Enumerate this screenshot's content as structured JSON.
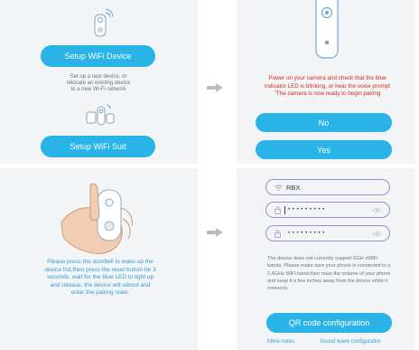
{
  "setup": {
    "wifi_device_label": "Setup WiFi Device",
    "wifi_device_desc": [
      "Set up a new device, or",
      "relocate an existing device",
      "to a new Wi-Fi network"
    ],
    "wifi_suit_label": "Setup WiFi Suit"
  },
  "power_step": {
    "instruction": "Power on your camera and check that the blue indicator LED is blinking, or hear the voice prompt \"The camera is now ready to begin pairing",
    "no_label": "No",
    "yes_label": "Yes"
  },
  "doorbell_step": {
    "instruction": "Please press the doorbell to wake up the device frst,then press the reset button for 3 seconds, wait for the blue LED to light up and release, the device will reboot and enter the pairing state."
  },
  "wifi_form": {
    "ssid": "RBX",
    "password_mask": "• • • • • • • • •",
    "confirm_mask": "• • • • • • • • •",
    "note": "The device does not currently support 5GH zWiFi bands. Please make sure your phone is connected to a 2.4GHz WiFi band,then raise the volume of your phone and keep it a few inches away from the device while it connects",
    "qr_label": "QR code configuration",
    "more_notes": "More notes",
    "sound_wave": "Sound wave configuratior"
  },
  "colors": {
    "accent": "#29b3e6",
    "panel_bg": "#f3f4f6",
    "warning": "#d42a1f",
    "field_border": "#9a8fd0"
  }
}
